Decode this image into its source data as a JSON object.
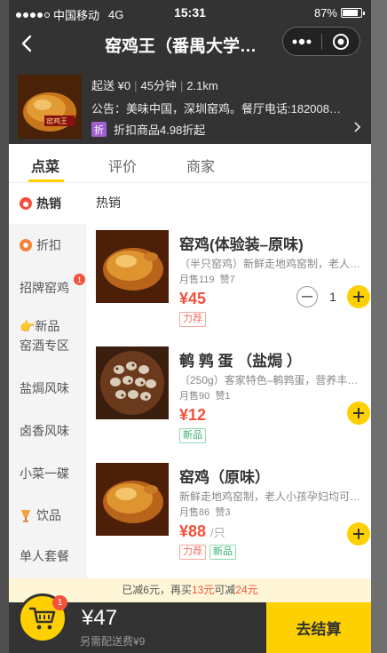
{
  "status_bar": {
    "carrier": "中国移动",
    "network": "4G",
    "time": "15:31",
    "battery": "87%"
  },
  "nav": {
    "title": "窑鸡王（番禺大学…"
  },
  "shop": {
    "logo_text": "窑鸡王",
    "min_order": "起送 ¥0",
    "delivery_time": "45分钟",
    "distance": "2.1km",
    "notice": "公告：美味中国，深圳窑鸡。餐厅电话:182008…",
    "discount_tag": "折",
    "discount_text": "折扣商品4.98折起"
  },
  "tabs": [
    {
      "label": "点菜"
    },
    {
      "label": "评价"
    },
    {
      "label": "商家"
    }
  ],
  "sidebar": {
    "items": [
      {
        "label": "热销",
        "icon": "flame-icon",
        "active": true
      },
      {
        "label": "折扣",
        "icon": "discount-icon"
      },
      {
        "label": "招牌窑鸡",
        "badge": "1"
      },
      {
        "label_line1": "👉新品",
        "label_line2": "窑酒专区"
      },
      {
        "label": "盐焗风味"
      },
      {
        "label": "卤香风味"
      },
      {
        "label": "小菜一碟"
      },
      {
        "label": "饮品",
        "icon": "drink-icon"
      },
      {
        "label": "单人套餐"
      }
    ]
  },
  "section_title": "热销",
  "items": [
    {
      "name": "窑鸡(体验装–原味)",
      "desc": "（半只窑鸡）新鲜走地鸡窑制，老人…",
      "sales": "月售119",
      "likes": "赞7",
      "price": "¥45",
      "unit": "",
      "tags": [
        "力荐"
      ],
      "qty": "1"
    },
    {
      "name": "鹌 鹑 蛋 （盐焗 ）",
      "desc": "（250g）客家特色–鹌鹑蛋，营养丰…",
      "sales": "月售90",
      "likes": "赞1",
      "price": "¥12",
      "unit": "",
      "tags": [
        "新品"
      ]
    },
    {
      "name": "窑鸡（原味）",
      "desc": "新鲜走地鸡窑制，老人小孩孕妇均可…",
      "sales": "月售86",
      "likes": "赞3",
      "price": "¥88",
      "unit": "/只",
      "tags": [
        "力荐",
        "新品"
      ]
    }
  ],
  "promo": {
    "part1": "已减6元，再买",
    "amount": "13元",
    "part2": "可减",
    "reduction": "24元"
  },
  "cart": {
    "badge": "1",
    "total": "¥47",
    "delivery_fee": "另需配送费¥9",
    "checkout_label": "去结算"
  },
  "colors": {
    "accent": "#ffd000",
    "price_red": "#f4513c",
    "dark": "#333333"
  }
}
